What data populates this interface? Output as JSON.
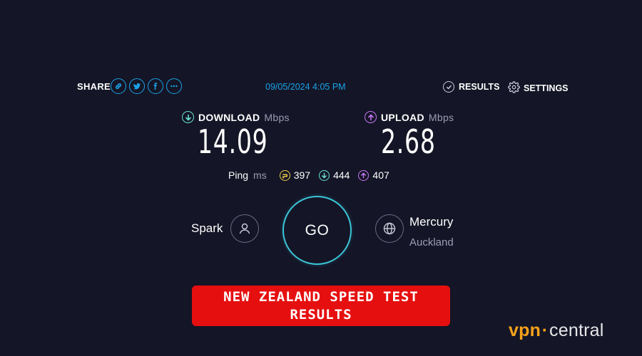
{
  "header": {
    "share_label": "SHARE",
    "share_icons": [
      "link-icon",
      "twitter-icon",
      "facebook-icon",
      "more-icon"
    ],
    "timestamp": "09/05/2024 4:05 PM",
    "results_label": "RESULTS",
    "settings_label": "SETTINGS"
  },
  "download": {
    "label": "DOWNLOAD",
    "unit": "Mbps",
    "value": "14.09"
  },
  "upload": {
    "label": "UPLOAD",
    "unit": "Mbps",
    "value": "2.68"
  },
  "ping": {
    "label": "Ping",
    "unit": "ms",
    "idle": "397",
    "download": "444",
    "upload": "407"
  },
  "isp": {
    "name": "Spark"
  },
  "server": {
    "name": "Mercury",
    "city": "Auckland"
  },
  "go_label": "GO",
  "banner": {
    "text": "NEW ZEALAND SPEED TEST RESULTS"
  },
  "watermark": {
    "part1": "vpn",
    "part2": "central"
  },
  "colors": {
    "background": "#141526",
    "accent_blue": "#1aa3e8",
    "download_teal": "#69e2d1",
    "upload_purple": "#c678f5",
    "ping_yellow": "#f2cf4a",
    "go_ring": "#3bc5d8",
    "banner_red": "#e60f0f",
    "watermark_orange": "#f6a21a"
  }
}
